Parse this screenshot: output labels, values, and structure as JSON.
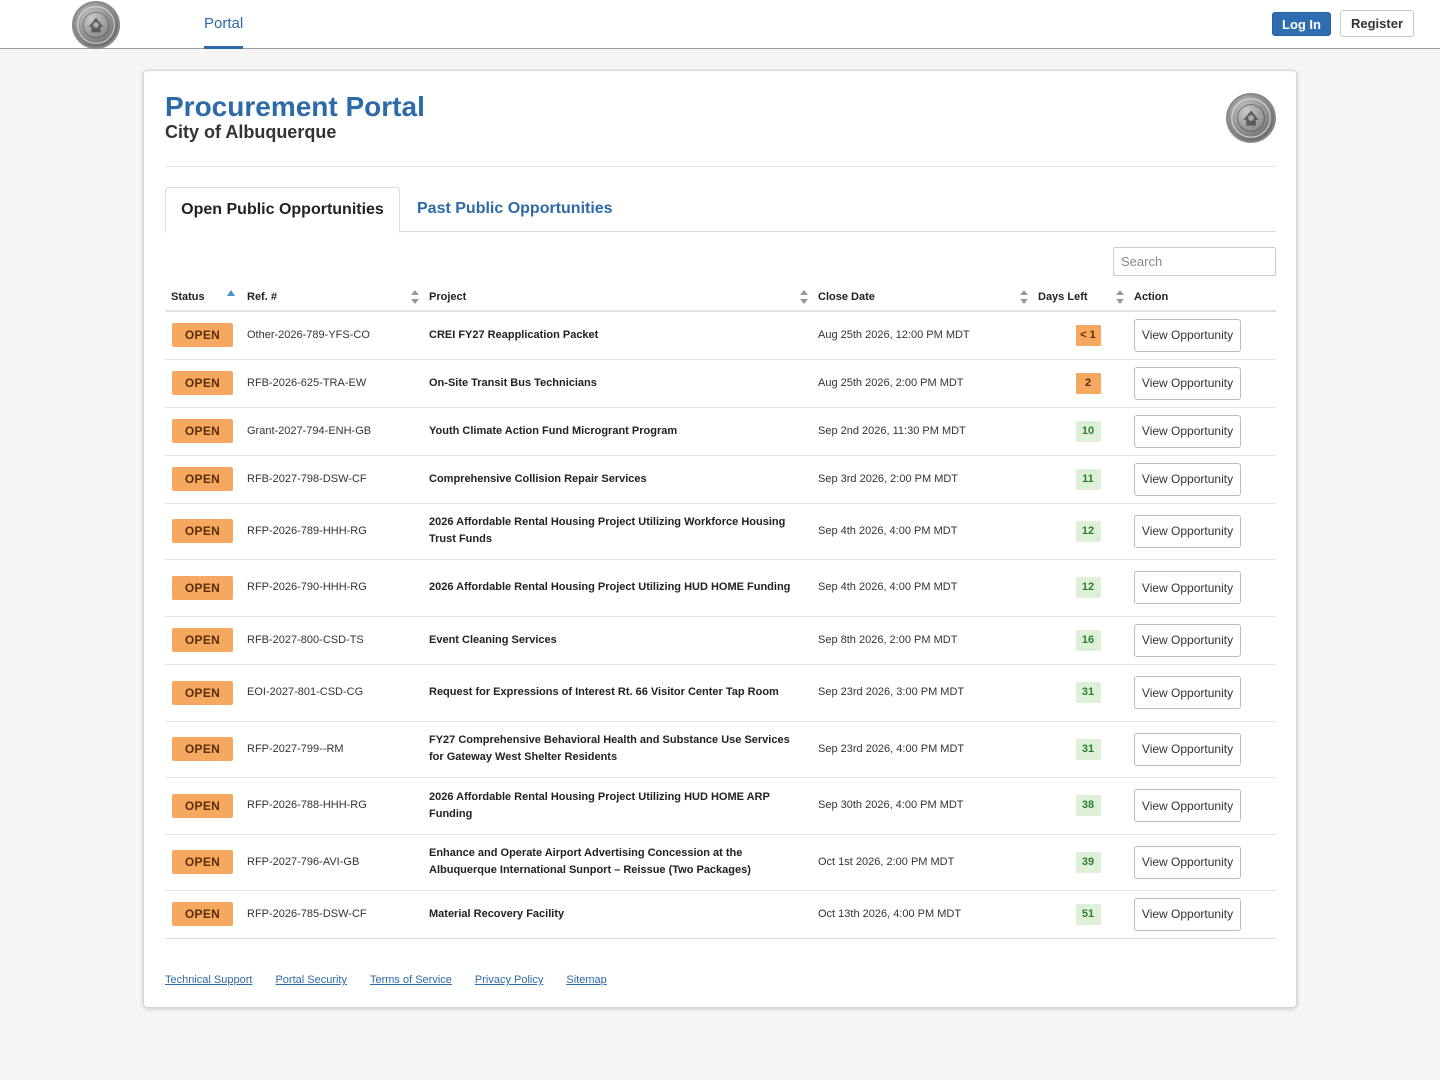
{
  "nav": {
    "portal_label": "Portal",
    "login_label": "Log In",
    "register_label": "Register"
  },
  "header": {
    "title": "Procurement Portal",
    "subtitle": "City of Albuquerque"
  },
  "tabs": [
    {
      "label": "Open Public Opportunities",
      "active": true
    },
    {
      "label": "Past Public Opportunities",
      "active": false
    }
  ],
  "search": {
    "placeholder": "Search",
    "value": ""
  },
  "table": {
    "columns": [
      "Status",
      "Ref. #",
      "Project",
      "Close Date",
      "Days Left",
      "Action"
    ],
    "sorted_column": "Status",
    "rows": [
      {
        "status": "OPEN",
        "ref": "Other-2026-789-YFS-CO",
        "project": "CREI FY27 Reapplication Packet",
        "close": "Aug 25th 2026, 12:00 PM MDT",
        "days": "< 1",
        "days_color": "orange",
        "action": "View Opportunity"
      },
      {
        "status": "OPEN",
        "ref": "RFB-2026-625-TRA-EW",
        "project": "On-Site Transit Bus Technicians",
        "close": "Aug 25th 2026, 2:00 PM MDT",
        "days": "2",
        "days_color": "orange",
        "action": "View Opportunity"
      },
      {
        "status": "OPEN",
        "ref": "Grant-2027-794-ENH-GB",
        "project": "Youth Climate Action Fund Microgrant Program",
        "close": "Sep 2nd 2026, 11:30 PM MDT",
        "days": "10",
        "days_color": "green",
        "action": "View Opportunity"
      },
      {
        "status": "OPEN",
        "ref": "RFB-2027-798-DSW-CF",
        "project": "Comprehensive Collision Repair Services",
        "close": "Sep 3rd 2026, 2:00 PM MDT",
        "days": "11",
        "days_color": "green",
        "action": "View Opportunity"
      },
      {
        "status": "OPEN",
        "ref": "RFP-2026-789-HHH-RG",
        "project": "2026 Affordable Rental Housing Project Utilizing Workforce Housing Trust Funds",
        "close": "Sep 4th 2026, 4:00 PM MDT",
        "days": "12",
        "days_color": "green",
        "action": "View Opportunity"
      },
      {
        "status": "OPEN",
        "ref": "RFP-2026-790-HHH-RG",
        "project": "2026 Affordable Rental Housing Project Utilizing HUD HOME Funding",
        "close": "Sep 4th 2026, 4:00 PM MDT",
        "days": "12",
        "days_color": "green",
        "action": "View Opportunity"
      },
      {
        "status": "OPEN",
        "ref": "RFB-2027-800-CSD-TS",
        "project": "Event Cleaning Services",
        "close": "Sep 8th 2026, 2:00 PM MDT",
        "days": "16",
        "days_color": "green",
        "action": "View Opportunity"
      },
      {
        "status": "OPEN",
        "ref": "EOI-2027-801-CSD-CG",
        "project": "Request for Expressions of Interest Rt. 66 Visitor Center Tap Room",
        "close": "Sep 23rd 2026, 3:00 PM MDT",
        "days": "31",
        "days_color": "green",
        "action": "View Opportunity"
      },
      {
        "status": "OPEN",
        "ref": "RFP-2027-799--RM",
        "project": "FY27 Comprehensive Behavioral Health and Substance Use Services for Gateway West Shelter Residents",
        "close": "Sep 23rd 2026, 4:00 PM MDT",
        "days": "31",
        "days_color": "green",
        "action": "View Opportunity"
      },
      {
        "status": "OPEN",
        "ref": "RFP-2026-788-HHH-RG",
        "project": "2026 Affordable Rental Housing Project Utilizing HUD HOME ARP Funding",
        "close": "Sep 30th 2026, 4:00 PM MDT",
        "days": "38",
        "days_color": "green",
        "action": "View Opportunity"
      },
      {
        "status": "OPEN",
        "ref": "RFP-2027-796-AVI-GB",
        "project": "Enhance and Operate Airport Advertising Concession at the Albuquerque International Sunport – Reissue (Two Packages)",
        "close": "Oct 1st 2026, 2:00 PM MDT",
        "days": "39",
        "days_color": "green",
        "action": "View Opportunity"
      },
      {
        "status": "OPEN",
        "ref": "RFP-2026-785-DSW-CF",
        "project": "Material Recovery Facility",
        "close": "Oct 13th 2026, 4:00 PM MDT",
        "days": "51",
        "days_color": "green",
        "action": "View Opportunity"
      }
    ]
  },
  "footer": {
    "links": [
      "Technical Support",
      "Portal Security",
      "Terms of Service",
      "Privacy Policy",
      "Sitemap"
    ]
  },
  "colors": {
    "brand": "#2c6aa8",
    "open_badge": "#f6a860",
    "days_green_bg": "#dff0d8",
    "days_green_text": "#2e7d32"
  }
}
